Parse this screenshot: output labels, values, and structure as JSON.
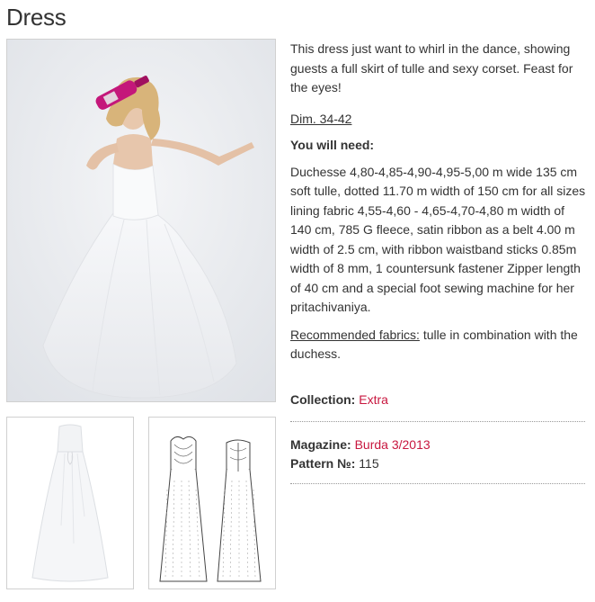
{
  "page": {
    "title": "Dress"
  },
  "images": {
    "main_alt": "Model in white strapless tulle dress holding pink bottle",
    "thumb1_alt": "White strapless tulle gown",
    "thumb2_alt": "Technical drawing of dress front and back"
  },
  "content": {
    "description": "This dress just want to whirl in the dance, showing guests a full skirt of tulle and sexy corset. Feast for the eyes!",
    "dim": "Dim. 34-42",
    "need_heading": "You will need:",
    "need_text": "Duchesse 4,80-4,85-4,90-4,95-5,00 m wide 135 cm soft tulle, dotted 11.70 m width of 150 cm for all sizes lining fabric 4,55-4,60 - 4,65-4,70-4,80 m width of 140 cm, 785 G fleece, satin ribbon as a belt 4.00 m width of 2.5 cm, with ribbon waistband sticks 0.85m width of 8 mm, 1 countersunk fastener Zipper length of 40 cm and a special foot sewing machine for her pritachivaniya.",
    "recommended_label": "Recommended fabrics:",
    "recommended_text": " tulle in combination with the duchess.",
    "collection_label": "Collection:",
    "collection_value": "Extra",
    "magazine_label": "Magazine:",
    "magazine_value": "Burda 3/2013",
    "pattern_label": "Pattern №:",
    "pattern_value": "115"
  },
  "colors": {
    "accent": "#c8173f",
    "text": "#333333",
    "border": "#d0d0d0"
  }
}
